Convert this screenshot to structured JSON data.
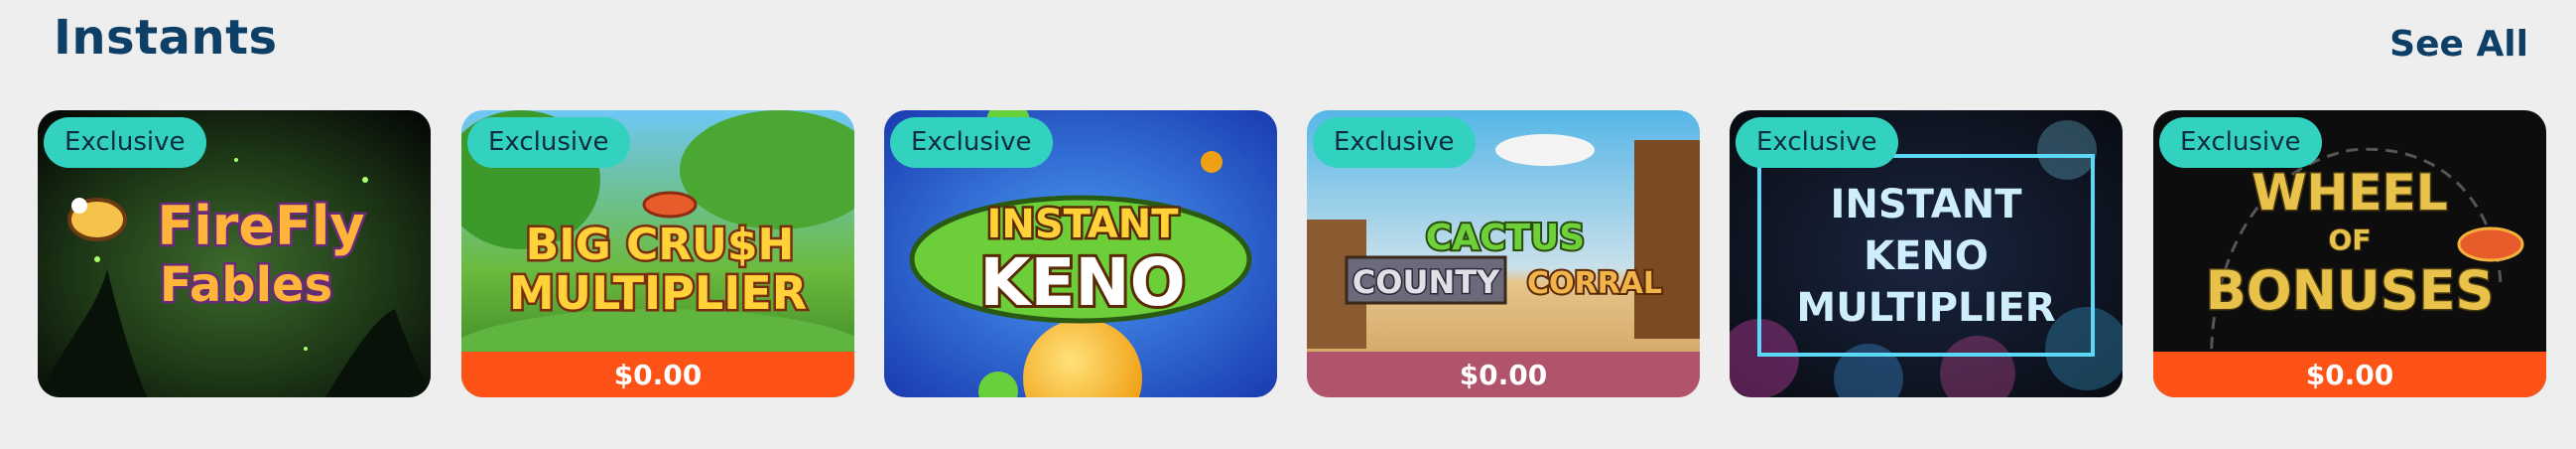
{
  "section": {
    "title": "Instants",
    "see_all": "See All"
  },
  "colors": {
    "title": "#0e3f66",
    "badge": "#33d1bf",
    "price_orange": "#ff5216",
    "price_pink": "#b0546c"
  },
  "games": [
    {
      "badge": "Exclusive",
      "art_lines": [
        "FireFly",
        "Fables"
      ],
      "price": null
    },
    {
      "badge": "Exclusive",
      "art_lines": [
        "BIG CRU$H",
        "MULTIPLIER"
      ],
      "price": "$0.00"
    },
    {
      "badge": "Exclusive",
      "art_lines": [
        "INSTANT",
        "KENO"
      ],
      "price": null
    },
    {
      "badge": "Exclusive",
      "art_lines": [
        "CACTUS",
        "COUNTY",
        "CORRAL"
      ],
      "price": "$0.00"
    },
    {
      "badge": "Exclusive",
      "art_lines": [
        "INSTANT",
        "KENO",
        "MULTIPLIER"
      ],
      "price": null
    },
    {
      "badge": "Exclusive",
      "art_lines": [
        "WHEEL",
        "OF",
        "BONUSES"
      ],
      "price": "$0.00"
    }
  ]
}
